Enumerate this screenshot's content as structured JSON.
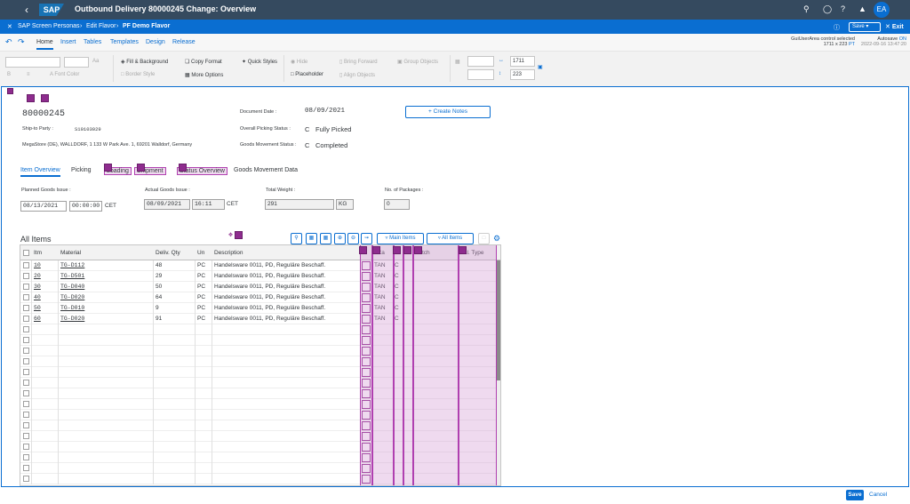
{
  "shell": {
    "title": "Outbound Delivery 80000245 Change: Overview",
    "logo": "SAP",
    "avatar": "EA"
  },
  "bar2": {
    "crumb1": "SAP Screen Personas",
    "crumb2": "Edit Flavor",
    "crumb3": "PF Demo Flavor",
    "save": "Save",
    "exit": "Exit"
  },
  "bar3": {
    "tabs": [
      "Home",
      "Insert",
      "Tables",
      "Templates",
      "Design",
      "Release"
    ],
    "sel1": "GuiUserArea control selected",
    "sel2": "1711 x 223",
    "sel3": "PT",
    "auto": "Autosave",
    "auto_on": "ON",
    "date": "2022-09-16 13:47:20"
  },
  "ribbon": {
    "font_color": "Font Color",
    "fill": "Fill & Background",
    "border": "Border Style",
    "copy": "Copy Format",
    "quick": "Quick Styles",
    "more": "More Options",
    "hide": "Hide",
    "bring": "Bring Forward",
    "group": "Group Objects",
    "placeholder": "Placeholder",
    "align": "Align Objects",
    "w": "1711",
    "h": "223"
  },
  "header": {
    "doc": "80000245",
    "ship_label": "Ship-to Party :",
    "ship": "S10103029",
    "addr": "MegaStore (DE), WALLDORF, 1 133 W Park Ave. 1, 69201 Walldorf, Germany",
    "docdate_label": "Document Date :",
    "docdate": "08/09/2021",
    "pick_label": "Overall Picking Status :",
    "pick_code": "C",
    "pick": "Fully Picked",
    "gm_label": "Goods Movement Status :",
    "gm_code": "C",
    "gm": "Completed",
    "create_notes": "+ Create Notes"
  },
  "tabs": [
    "Item Overview",
    "Picking",
    "Loading",
    "Shipment",
    "Status Overview",
    "Goods Movement Data"
  ],
  "fields": {
    "pgi_label": "Planned Goods Issue :",
    "pgi_date": "08/13/2021",
    "pgi_time": "00:00:00",
    "pgi_tz": "CET",
    "agi_label": "Actual Goods Issue :",
    "agi_date": "08/09/2021",
    "agi_time": "16:11",
    "agi_tz": "CET",
    "tw_label": "Total Weight :",
    "tw": "291",
    "tw_unit": "KG",
    "np_label": "No. of Packages :",
    "np": "0"
  },
  "items": {
    "title": "All Items",
    "btn_main": "Main Items",
    "btn_all": "All Items",
    "headers": [
      "Itm",
      "Material",
      "Deliv. Qty",
      "Un",
      "Description",
      "ItCa",
      "Batch",
      "Val. Type"
    ],
    "rows": [
      [
        "10",
        "TG-D112",
        "48",
        "PC",
        "Handelsware 0011, PD, Reguläre Beschaff.",
        "TAN",
        "C"
      ],
      [
        "20",
        "TG-D501",
        "29",
        "PC",
        "Handelsware 0011, PD, Reguläre Beschaff.",
        "TAN",
        "C"
      ],
      [
        "30",
        "TG-D040",
        "50",
        "PC",
        "Handelsware 0011, PD, Reguläre Beschaff.",
        "TAN",
        "C"
      ],
      [
        "40",
        "TG-D020",
        "64",
        "PC",
        "Handelsware 0011, PD, Reguläre Beschaff.",
        "TAN",
        "C"
      ],
      [
        "50",
        "TG-D010",
        "9",
        "PC",
        "Handelsware 0011, PD, Reguläre Beschaff.",
        "TAN",
        "C"
      ],
      [
        "60",
        "TG-D020",
        "91",
        "PC",
        "Handelsware 0011, PD, Reguläre Beschaff.",
        "TAN",
        "C"
      ]
    ]
  },
  "footer": {
    "save": "Save",
    "cancel": "Cancel"
  }
}
